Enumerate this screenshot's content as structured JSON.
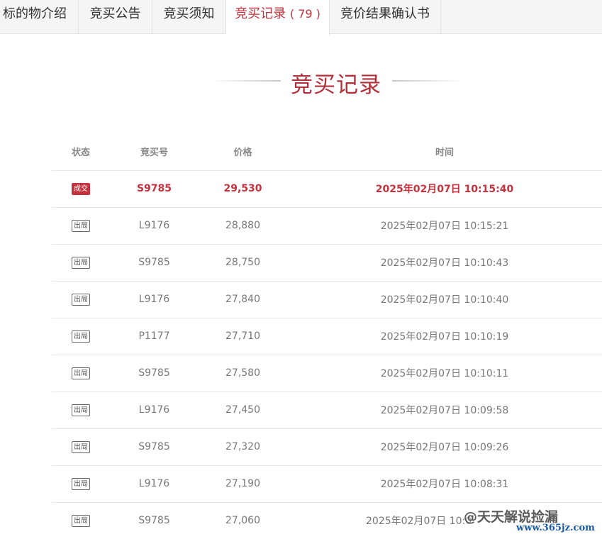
{
  "tabs": [
    {
      "label": "标的物介绍",
      "count": ""
    },
    {
      "label": "竞买公告",
      "count": ""
    },
    {
      "label": "竞买须知",
      "count": ""
    },
    {
      "label": "竞买记录",
      "count": "( 79 )"
    },
    {
      "label": "竞价结果确认书",
      "count": ""
    }
  ],
  "active_tab_index": 3,
  "section": {
    "title": "竞买记录"
  },
  "table": {
    "headers": {
      "status": "状态",
      "bidder": "竞买号",
      "price": "价格",
      "time": "时间"
    },
    "rows": [
      {
        "status": "成交",
        "bidder": "S9785",
        "price": "29,530",
        "time": "2025年02月07日 10:15:40"
      },
      {
        "status": "出局",
        "bidder": "L9176",
        "price": "28,880",
        "time": "2025年02月07日 10:15:21"
      },
      {
        "status": "出局",
        "bidder": "S9785",
        "price": "28,750",
        "time": "2025年02月07日 10:10:43"
      },
      {
        "status": "出局",
        "bidder": "L9176",
        "price": "27,840",
        "time": "2025年02月07日 10:10:40"
      },
      {
        "status": "出局",
        "bidder": "P1177",
        "price": "27,710",
        "time": "2025年02月07日 10:10:19"
      },
      {
        "status": "出局",
        "bidder": "S9785",
        "price": "27,580",
        "time": "2025年02月07日 10:10:11"
      },
      {
        "status": "出局",
        "bidder": "L9176",
        "price": "27,450",
        "time": "2025年02月07日 10:09:58"
      },
      {
        "status": "出局",
        "bidder": "S9785",
        "price": "27,320",
        "time": "2025年02月07日 10:09:26"
      },
      {
        "status": "出局",
        "bidder": "L9176",
        "price": "27,190",
        "time": "2025年02月07日 10:08:31"
      },
      {
        "status": "出局",
        "bidder": "S9785",
        "price": "27,060",
        "time": "2025年02月07日 10:0"
      }
    ]
  },
  "watermark": {
    "text": "@天天解说捡漏",
    "url": "www.365jz.com"
  },
  "colors": {
    "accent": "#c4323d",
    "heading": "#b3303a",
    "tab_bar_bg": "#f5f5f5",
    "border": "#e6e6e6"
  }
}
